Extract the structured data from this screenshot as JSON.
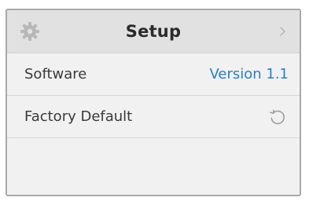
{
  "header": {
    "title": "Setup",
    "left_icon": "gear-icon",
    "right_icon": "chevron-right-icon"
  },
  "rows": [
    {
      "label": "Software",
      "value": "Version 1.1"
    },
    {
      "label": "Factory Default",
      "icon": "reset-icon"
    }
  ],
  "colors": {
    "header_bg": "#e1e1e1",
    "panel_bg": "#f1f1f1",
    "accent": "#2d7ec4",
    "border": "#a9a9a9"
  }
}
